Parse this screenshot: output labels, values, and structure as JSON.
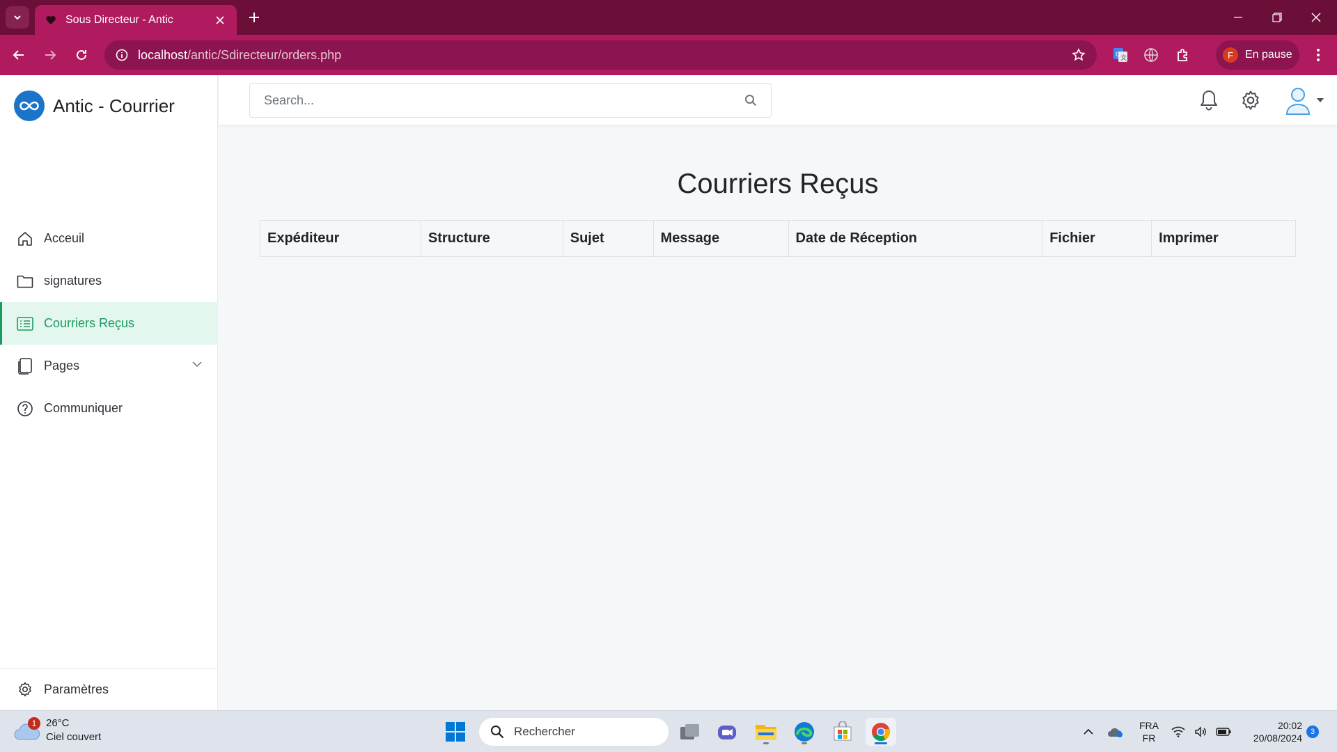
{
  "browser": {
    "tab_title": "Sous Directeur - Antic",
    "url_host": "localhost",
    "url_path": "/antic/Sdirecteur/orders.php",
    "profile_initial": "F",
    "profile_status": "En pause"
  },
  "app": {
    "brand_name": "Antic - Courrier",
    "search_placeholder": "Search..."
  },
  "sidebar": {
    "items": [
      {
        "label": "Acceuil",
        "icon": "home-icon",
        "active": false
      },
      {
        "label": "signatures",
        "icon": "folder-icon",
        "active": false
      },
      {
        "label": "Courriers Reçus",
        "icon": "list-icon",
        "active": true
      },
      {
        "label": "Pages",
        "icon": "pages-icon",
        "active": false
      },
      {
        "label": "Communiquer",
        "icon": "help-circle-icon",
        "active": false
      }
    ],
    "footer_label": "Paramètres"
  },
  "main": {
    "title": "Courriers Reçus",
    "table_headers": [
      "Expéditeur",
      "Structure",
      "Sujet",
      "Message",
      "Date de Réception",
      "Fichier",
      "Imprimer"
    ]
  },
  "taskbar": {
    "weather_temp": "26°C",
    "weather_desc": "Ciel couvert",
    "weather_badge": "1",
    "search_label": "Rechercher",
    "lang_top": "FRA",
    "lang_bottom": "FR",
    "time": "20:02",
    "date": "20/08/2024",
    "notif_count": "3"
  },
  "colors": {
    "browser_frame": "#6b0f38",
    "browser_toolbar": "#b01a5e",
    "active_nav": "#1c9a62",
    "brand_logo": "#1b74c9"
  }
}
